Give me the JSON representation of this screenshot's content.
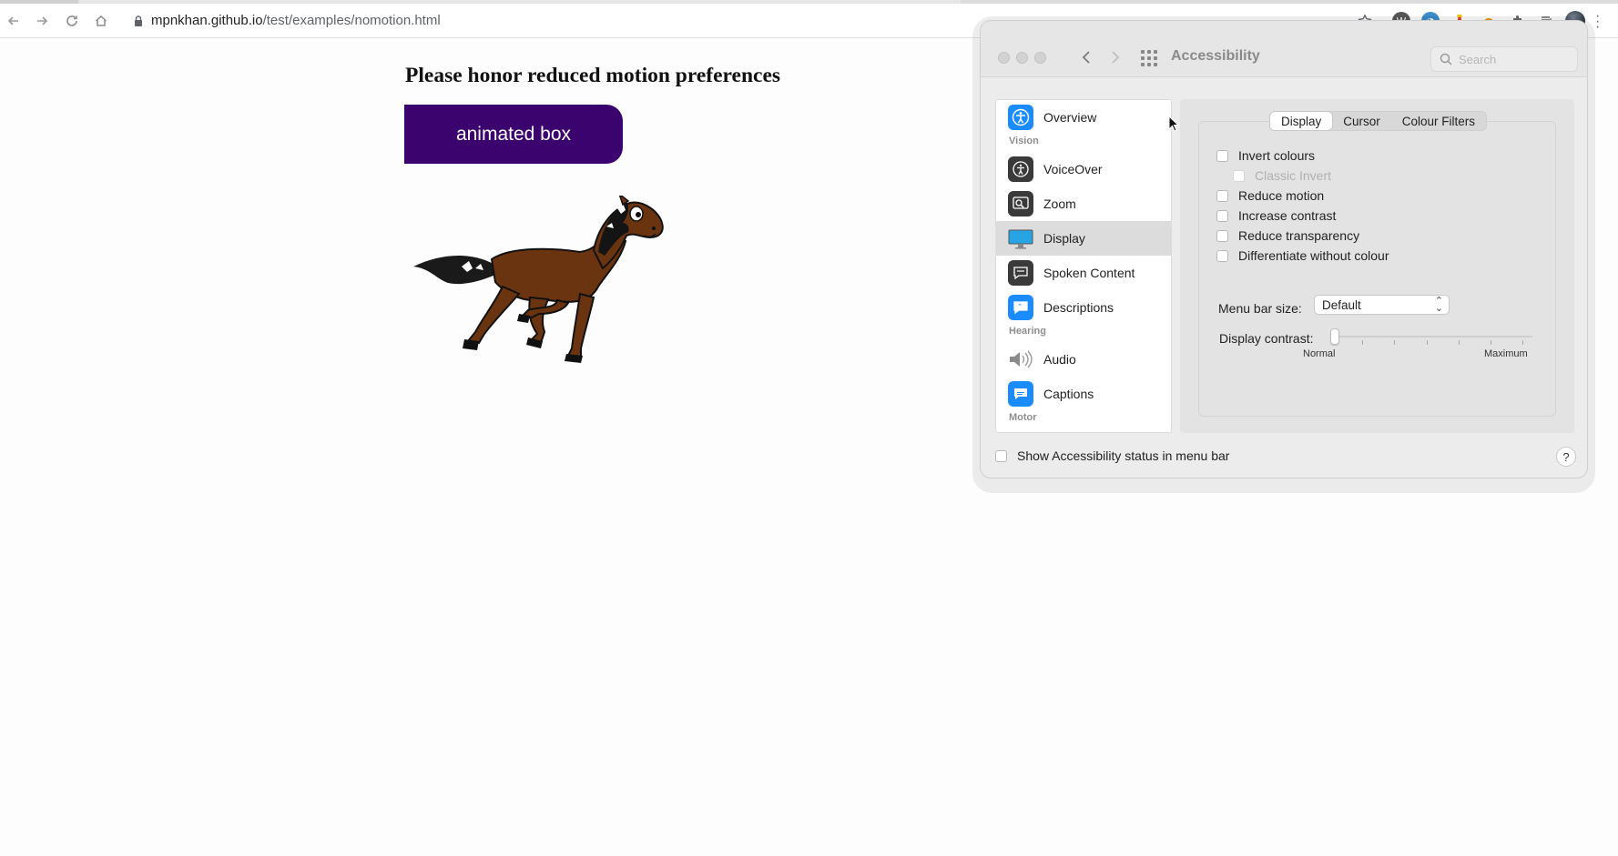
{
  "browser": {
    "url_host": "mpnkhan.github.io",
    "url_path": "/test/examples/nomotion.html"
  },
  "page": {
    "heading": "Please honor reduced motion preferences",
    "animated_box_label": "animated box"
  },
  "accessibility_window": {
    "title": "Accessibility",
    "search_placeholder": "Search",
    "sidebar": {
      "overview": "Overview",
      "vision_header": "Vision",
      "voiceover": "VoiceOver",
      "zoom": "Zoom",
      "display": "Display",
      "spoken_content": "Spoken Content",
      "descriptions": "Descriptions",
      "hearing_header": "Hearing",
      "audio": "Audio",
      "captions": "Captions",
      "motor_header": "Motor",
      "selected": "Display"
    },
    "tabs": {
      "display": "Display",
      "cursor": "Cursor",
      "colour_filters": "Colour Filters",
      "active": "Display"
    },
    "options": {
      "invert_colours": "Invert colours",
      "classic_invert": "Classic Invert",
      "reduce_motion": "Reduce motion",
      "increase_contrast": "Increase contrast",
      "reduce_transparency": "Reduce transparency",
      "differentiate": "Differentiate without colour"
    },
    "menu_bar_size_label": "Menu bar size:",
    "menu_bar_size_value": "Default",
    "display_contrast_label": "Display contrast:",
    "display_contrast_min": "Normal",
    "display_contrast_max": "Maximum",
    "display_contrast_level": 0,
    "status_checkbox_label": "Show Accessibility status in menu bar",
    "help_label": "?"
  },
  "colors": {
    "animated_box": "#3a036e",
    "accent_blue": "#1a8cff"
  }
}
